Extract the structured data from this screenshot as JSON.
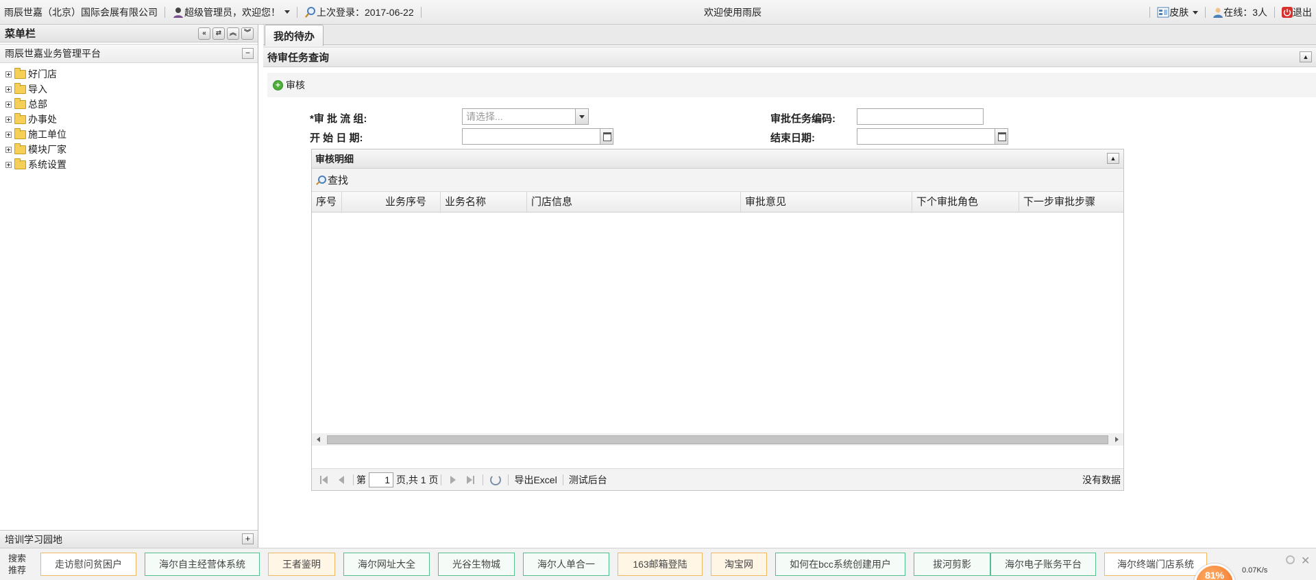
{
  "topbar": {
    "company": "雨辰世嘉（北京）国际会展有限公司",
    "user_greeting": "超级管理员，欢迎您！",
    "last_login": "上次登录：2017-06-22",
    "welcome": "欢迎使用雨辰",
    "skin": "皮肤",
    "online": "在线：3人",
    "logout": "退出"
  },
  "sidebar": {
    "title": "菜单栏",
    "platform": "雨辰世嘉业务管理平台",
    "items": [
      {
        "label": "好门店"
      },
      {
        "label": "导入"
      },
      {
        "label": "总部"
      },
      {
        "label": "办事处"
      },
      {
        "label": "施工单位"
      },
      {
        "label": "模块厂家"
      },
      {
        "label": "系统设置"
      }
    ],
    "training": "培训学习园地"
  },
  "tabs": [
    {
      "label": "我的待办"
    }
  ],
  "main": {
    "pending_title": "待审任务查询",
    "review_button": "审核",
    "form": {
      "flow_group_label": "*审 批 流 组:",
      "flow_group_placeholder": "请选择...",
      "task_code_label": "审批任务编码:",
      "start_date_label": "开 始 日 期:",
      "end_date_label": "结束日期:"
    },
    "detail": {
      "title": "审核明细",
      "search_button": "查找",
      "columns": [
        "序号",
        "业务序号",
        "业务名称",
        "门店信息",
        "审批意见",
        "下个审批角色",
        "下一步审批步骤"
      ],
      "pager": {
        "page_prefix": "第",
        "page_value": "1",
        "page_suffix": "页,共 1 页",
        "export": "导出Excel",
        "test_backend": "测试后台",
        "no_data": "没有数据"
      }
    }
  },
  "bottombar": {
    "search_rec_line1": "搜索",
    "search_rec_line2": "推荐",
    "chips": [
      {
        "label": "走访慰问贫困户",
        "style": "orange"
      },
      {
        "label": "海尔自主经营体系统",
        "style": "green"
      },
      {
        "label": "王者鉴明",
        "style": "orange-filled"
      },
      {
        "label": "海尔网址大全",
        "style": "green"
      },
      {
        "label": "光谷生物城",
        "style": "green"
      },
      {
        "label": "海尔人单合一",
        "style": "green"
      },
      {
        "label": "163邮箱登陆",
        "style": "orange-filled"
      },
      {
        "label": "淘宝网",
        "style": "orange-filled"
      },
      {
        "label": "如何在bcc系统创建用户",
        "style": "green"
      },
      {
        "label": "拔河剪影",
        "style": "green"
      },
      {
        "label": "海尔电子账务平台",
        "style": "green"
      },
      {
        "label": "海尔终端门店系统",
        "style": "orange"
      }
    ],
    "ball_text": "81%",
    "speed": "0.07K/s"
  },
  "colors": {
    "accent_orange": "#f0b860",
    "accent_green": "#52c08e",
    "review_green": "#4faf3b"
  }
}
